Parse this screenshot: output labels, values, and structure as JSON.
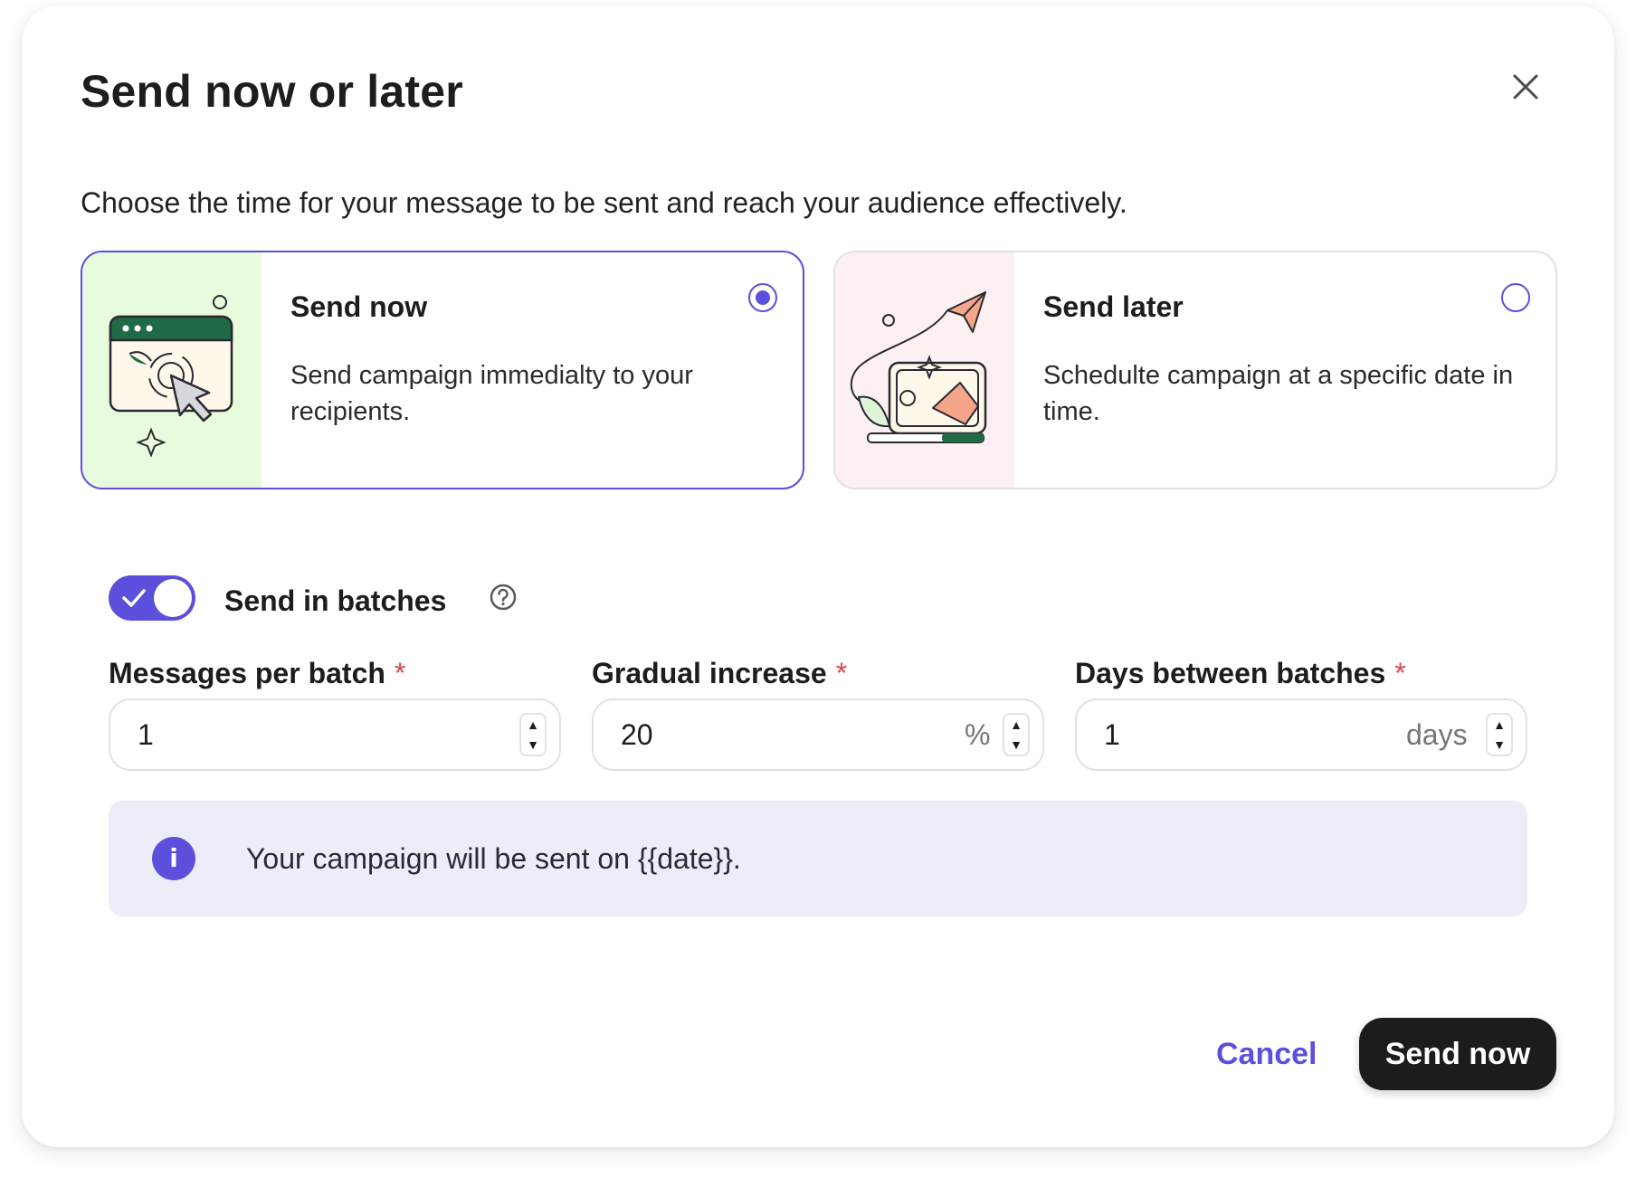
{
  "dialog": {
    "title": "Send now or later",
    "subtitle": "Choose the time for your message to be sent and reach your audience effectively."
  },
  "options": [
    {
      "title": "Send now",
      "description": "Send campaign immedialty to your recipients.",
      "selected": true,
      "icon": "browser-click-illustration",
      "art_bg": "#e8fbdc"
    },
    {
      "title": "Send later",
      "description": "Schedulte campaign at a specific date in time.",
      "selected": false,
      "icon": "laptop-paper-plane-illustration",
      "art_bg": "#fdf0f3"
    }
  ],
  "batches": {
    "toggle_label": "Send in batches",
    "enabled": true,
    "help_icon": "question-circle-icon"
  },
  "fields": [
    {
      "label": "Messages per batch",
      "required": "*",
      "value": "1",
      "unit": ""
    },
    {
      "label": "Gradual increase",
      "required": "*",
      "value": "20",
      "unit": "%"
    },
    {
      "label": "Days between batches",
      "required": "*",
      "value": "1",
      "unit": "days"
    }
  ],
  "stepper": {
    "up": "▲",
    "down": "▼"
  },
  "info": {
    "icon": "i",
    "text": "Your campaign will be sent on {{date}}."
  },
  "actions": {
    "cancel": "Cancel",
    "primary": "Send now"
  },
  "colors": {
    "accent": "#5b4fdc",
    "required": "#e0404a",
    "info_bg": "#ededfa",
    "primary_button": "#1c1c1e",
    "illustration_green": "#1f6b45",
    "illustration_coral": "#f4a58a"
  }
}
